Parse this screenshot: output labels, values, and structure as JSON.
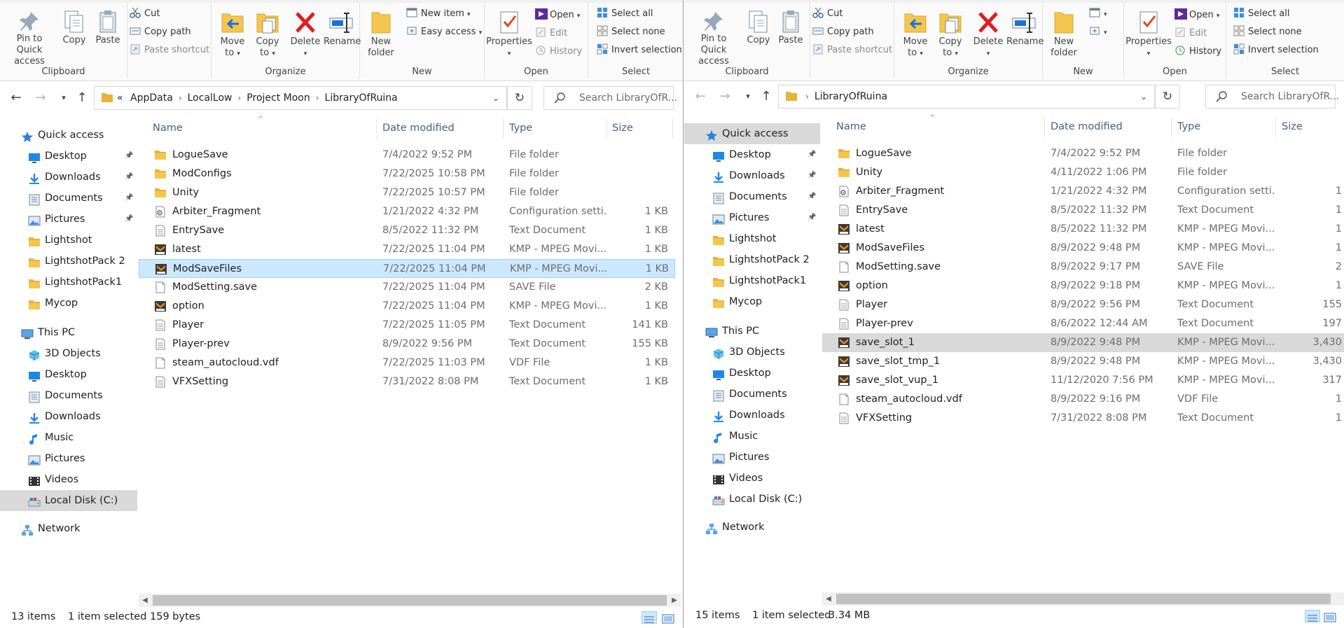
{
  "colors": {
    "accent": "#0078d7",
    "folder": "#e8b23b",
    "selected_bg": "#cce8ff",
    "selected_border": "#99d1ff",
    "grey_selected": "#d9d9d9",
    "header_text": "#4c607a",
    "delete_red": "#e01b22"
  },
  "ribbon": {
    "clipboard": {
      "label": "Clipboard",
      "pin_label_1": "Pin to Quick",
      "pin_label_2": "access",
      "copy": "Copy",
      "paste": "Paste",
      "cut": "Cut",
      "copy_path": "Copy path",
      "paste_shortcut": "Paste shortcut"
    },
    "organize": {
      "label": "Organize",
      "move_to_1": "Move",
      "move_to_2": "to",
      "copy_to_1": "Copy",
      "copy_to_2": "to",
      "delete": "Delete",
      "rename": "Rename"
    },
    "new": {
      "label": "New",
      "new_folder_1": "New",
      "new_folder_2": "folder",
      "new_item": "New item",
      "easy_access": "Easy access"
    },
    "open": {
      "label": "Open",
      "properties": "Properties",
      "open": "Open",
      "edit": "Edit",
      "history": "History"
    },
    "select": {
      "label": "Select",
      "select_all": "Select all",
      "select_none": "Select none",
      "invert_selection": "Invert selection"
    }
  },
  "left": {
    "address": {
      "overflow": "«",
      "crumbs": [
        "AppData",
        "LocalLow",
        "Project Moon",
        "LibraryOfRuina"
      ]
    },
    "search_placeholder": "Search LibraryOfR...",
    "columns": {
      "name": "Name",
      "date": "Date modified",
      "type": "Type",
      "size": "Size"
    },
    "nav": {
      "quick_access": "Quick access",
      "quick_items": [
        "Desktop",
        "Downloads",
        "Documents",
        "Pictures",
        "Lightshot",
        "LightshotPack 2",
        "LightshotPack1",
        "Mycop"
      ],
      "this_pc": "This PC",
      "pc_items": [
        "3D Objects",
        "Desktop",
        "Documents",
        "Downloads",
        "Music",
        "Pictures",
        "Videos",
        "Local Disk (C:)"
      ],
      "network": "Network"
    },
    "files": [
      {
        "name": "LogueSave",
        "date": "7/4/2022 9:52 PM",
        "type": "File folder",
        "size": "",
        "icon": "folder-icon"
      },
      {
        "name": "ModConfigs",
        "date": "7/22/2025 10:58 PM",
        "type": "File folder",
        "size": "",
        "icon": "folder-icon"
      },
      {
        "name": "Unity",
        "date": "7/22/2025 10:57 PM",
        "type": "File folder",
        "size": "",
        "icon": "folder-icon"
      },
      {
        "name": "Arbiter_Fragment",
        "date": "1/21/2022 4:32 PM",
        "type": "Configuration setti...",
        "size": "1 KB",
        "icon": "config-file-icon"
      },
      {
        "name": "EntrySave",
        "date": "8/5/2022 11:32 PM",
        "type": "Text Document",
        "size": "1 KB",
        "icon": "text-file-icon"
      },
      {
        "name": "latest",
        "date": "7/22/2025 11:04 PM",
        "type": "KMP - MPEG Movi...",
        "size": "1 KB",
        "icon": "dat-file-icon"
      },
      {
        "name": "ModSaveFiles",
        "date": "7/22/2025 11:04 PM",
        "type": "KMP - MPEG Movi...",
        "size": "1 KB",
        "icon": "dat-file-icon"
      },
      {
        "name": "ModSetting.save",
        "date": "7/22/2025 11:04 PM",
        "type": "SAVE File",
        "size": "2 KB",
        "icon": "blank-file-icon"
      },
      {
        "name": "option",
        "date": "7/22/2025 11:04 PM",
        "type": "KMP - MPEG Movi...",
        "size": "1 KB",
        "icon": "dat-file-icon"
      },
      {
        "name": "Player",
        "date": "7/22/2025 11:05 PM",
        "type": "Text Document",
        "size": "141 KB",
        "icon": "text-file-icon"
      },
      {
        "name": "Player-prev",
        "date": "8/9/2022 9:56 PM",
        "type": "Text Document",
        "size": "155 KB",
        "icon": "text-file-icon"
      },
      {
        "name": "steam_autocloud.vdf",
        "date": "7/22/2025 11:03 PM",
        "type": "VDF File",
        "size": "1 KB",
        "icon": "blank-file-icon"
      },
      {
        "name": "VFXSetting",
        "date": "7/31/2022 8:08 PM",
        "type": "Text Document",
        "size": "1 KB",
        "icon": "text-file-icon"
      }
    ],
    "selected_index": 6,
    "status": {
      "count": "13 items",
      "selected": "1 item selected",
      "size": "159 bytes"
    }
  },
  "right": {
    "address": {
      "crumbs": [
        "LibraryOfRuina"
      ]
    },
    "search_placeholder": "Search LibraryOfR...",
    "columns": {
      "name": "Name",
      "date": "Date modified",
      "type": "Type",
      "size": "Size"
    },
    "nav": {
      "quick_access": "Quick access",
      "quick_items": [
        "Desktop",
        "Downloads",
        "Documents",
        "Pictures",
        "Lightshot",
        "LightshotPack 2",
        "LightshotPack1",
        "Mycop"
      ],
      "this_pc": "This PC",
      "pc_items": [
        "3D Objects",
        "Desktop",
        "Documents",
        "Downloads",
        "Music",
        "Pictures",
        "Videos",
        "Local Disk (C:)"
      ],
      "network": "Network"
    },
    "files": [
      {
        "name": "LogueSave",
        "date": "7/4/2022 9:52 PM",
        "type": "File folder",
        "size": "",
        "icon": "folder-icon"
      },
      {
        "name": "Unity",
        "date": "4/11/2022 1:06 PM",
        "type": "File folder",
        "size": "",
        "icon": "folder-icon"
      },
      {
        "name": "Arbiter_Fragment",
        "date": "1/21/2022 4:32 PM",
        "type": "Configuration setti...",
        "size": "1",
        "icon": "config-file-icon"
      },
      {
        "name": "EntrySave",
        "date": "8/5/2022 11:32 PM",
        "type": "Text Document",
        "size": "1",
        "icon": "text-file-icon"
      },
      {
        "name": "latest",
        "date": "8/5/2022 11:32 PM",
        "type": "KMP - MPEG Movi...",
        "size": "1",
        "icon": "dat-file-icon"
      },
      {
        "name": "ModSaveFiles",
        "date": "8/9/2022 9:48 PM",
        "type": "KMP - MPEG Movi...",
        "size": "1",
        "icon": "dat-file-icon"
      },
      {
        "name": "ModSetting.save",
        "date": "8/9/2022 9:17 PM",
        "type": "SAVE File",
        "size": "2",
        "icon": "blank-file-icon"
      },
      {
        "name": "option",
        "date": "8/9/2022 9:18 PM",
        "type": "KMP - MPEG Movi...",
        "size": "1",
        "icon": "dat-file-icon"
      },
      {
        "name": "Player",
        "date": "8/9/2022 9:56 PM",
        "type": "Text Document",
        "size": "155",
        "icon": "text-file-icon"
      },
      {
        "name": "Player-prev",
        "date": "8/6/2022 12:44 AM",
        "type": "Text Document",
        "size": "197",
        "icon": "text-file-icon"
      },
      {
        "name": "save_slot_1",
        "date": "8/9/2022 9:48 PM",
        "type": "KMP - MPEG Movi...",
        "size": "3,430",
        "icon": "dat-file-icon"
      },
      {
        "name": "save_slot_tmp_1",
        "date": "8/9/2022 9:48 PM",
        "type": "KMP - MPEG Movi...",
        "size": "3,430",
        "icon": "dat-file-icon"
      },
      {
        "name": "save_slot_vup_1",
        "date": "11/12/2020 7:56 PM",
        "type": "KMP - MPEG Movi...",
        "size": "317",
        "icon": "dat-file-icon"
      },
      {
        "name": "steam_autocloud.vdf",
        "date": "8/9/2022 9:16 PM",
        "type": "VDF File",
        "size": "1",
        "icon": "blank-file-icon"
      },
      {
        "name": "VFXSetting",
        "date": "7/31/2022 8:08 PM",
        "type": "Text Document",
        "size": "1",
        "icon": "text-file-icon"
      }
    ],
    "selected_index": 10,
    "status": {
      "count": "15 items",
      "selected": "1 item selected",
      "size": "3.34 MB"
    }
  }
}
